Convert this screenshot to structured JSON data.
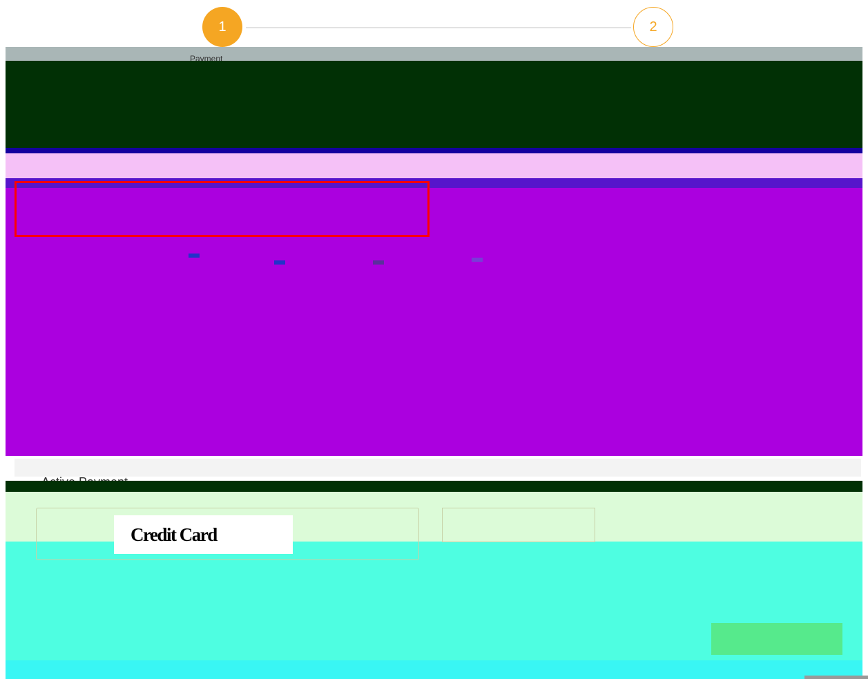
{
  "stepper": {
    "step1_number": "1",
    "step2_number": "2",
    "step1_label": "Payment"
  },
  "purple_panel": {
    "side_left_text": "",
    "tab_labels": [
      "",
      "",
      "",
      ""
    ]
  },
  "payment": {
    "section_title": "Active Payment",
    "method_label": "",
    "method_value": "Credit Card"
  }
}
